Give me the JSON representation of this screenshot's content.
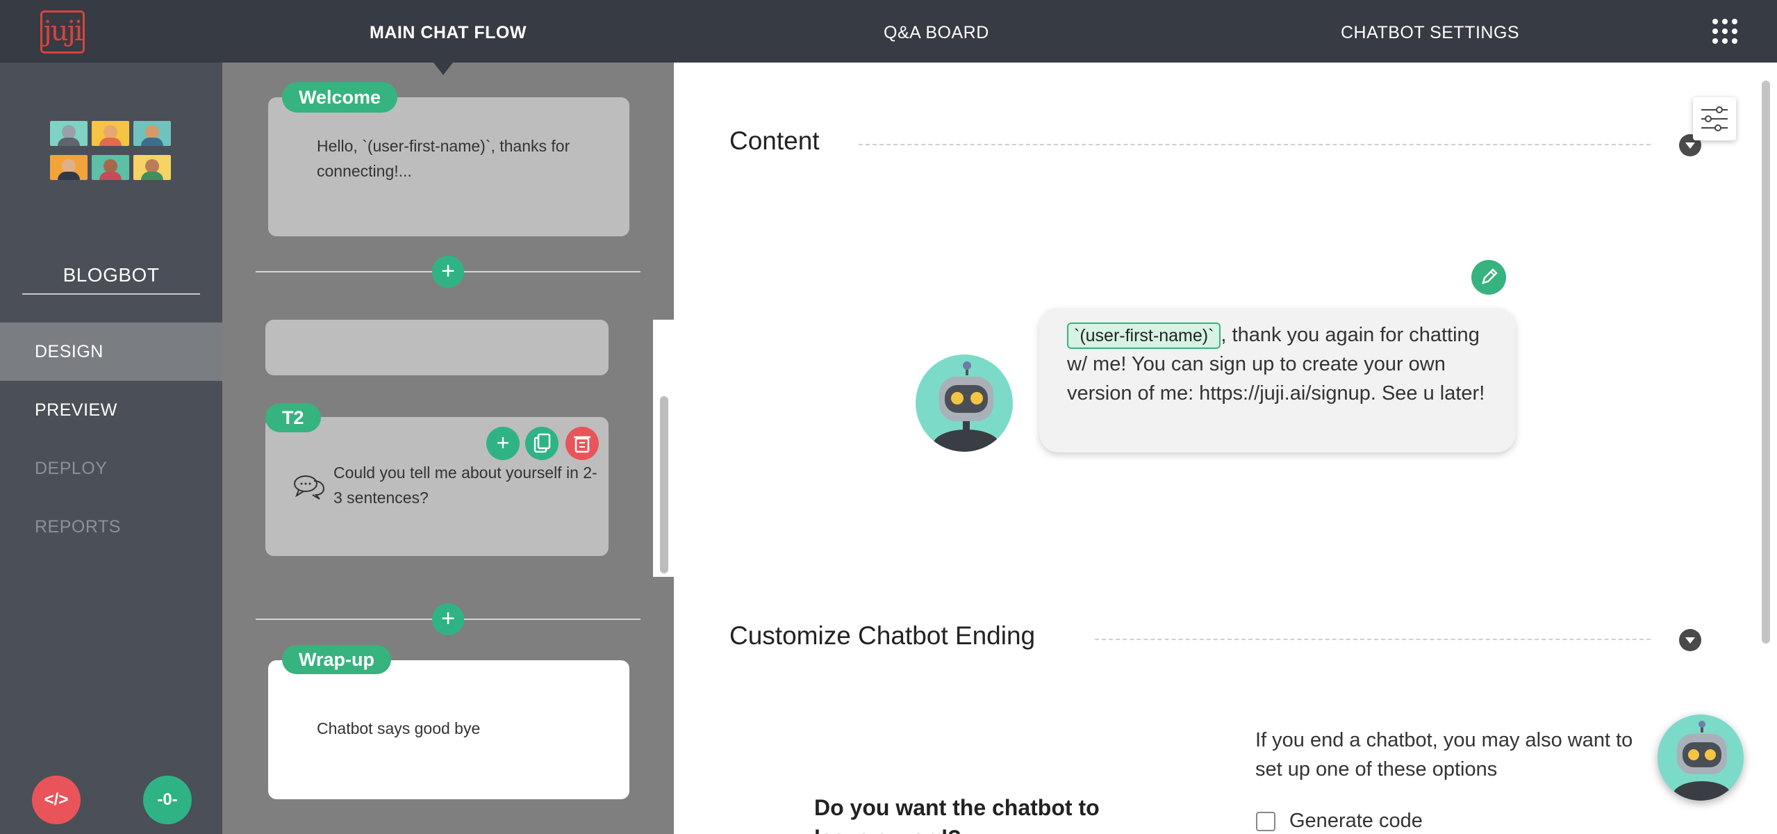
{
  "app": {
    "logo_text": "juji"
  },
  "nav": {
    "tabs": [
      {
        "label": "MAIN CHAT FLOW",
        "active": true
      },
      {
        "label": "Q&A BOARD",
        "active": false
      },
      {
        "label": "CHATBOT SETTINGS",
        "active": false
      }
    ],
    "apps_icon": "grid-apps-icon"
  },
  "sidebar": {
    "bot_name": "BLOGBOT",
    "items": [
      {
        "label": "DESIGN",
        "state": "active"
      },
      {
        "label": "PREVIEW",
        "state": "normal"
      },
      {
        "label": "DEPLOY",
        "state": "disabled"
      },
      {
        "label": "REPORTS",
        "state": "disabled"
      }
    ],
    "embed_button": "</>",
    "status_button": "-0-",
    "colors": {
      "embed": "#e9545a",
      "status": "#2fb385"
    }
  },
  "flow": {
    "welcome": {
      "tag": "Welcome",
      "text": "Hello, `(user-first-name)`, thanks for connecting!..."
    },
    "t2": {
      "tag": "T2",
      "text": "Could you tell me about yourself in 2-3 sentences?"
    },
    "wrapup": {
      "tag": "Wrap-up",
      "text": "Chatbot says good bye"
    }
  },
  "main": {
    "content_title": "Content",
    "bubble": {
      "variable": "`(user-first-name)`",
      "text": ", thank you again for chatting w/ me! You can sign up to create your own version of me: https://juji.ai/signup. See u later!"
    },
    "ending_title": "Customize Chatbot Ending",
    "question": "Do you want the chatbot to leave a word?",
    "options_hint": "If you end a chatbot, you may also want to set up one of these options",
    "option_generate_code": "Generate code"
  },
  "colors": {
    "accent": "#36b37e",
    "topbar": "#373b43",
    "sidebar": "#4b4f57",
    "flow_bg": "#7f7f7f",
    "danger": "#e9545a"
  }
}
